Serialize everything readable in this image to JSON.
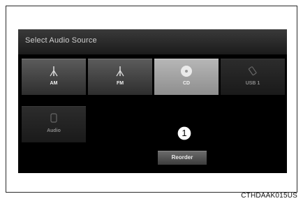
{
  "screen": {
    "header": {
      "title": "Select Audio Source"
    },
    "sources": [
      {
        "label": "AM",
        "icon": "antenna-icon",
        "state": "normal"
      },
      {
        "label": "FM",
        "icon": "antenna-icon",
        "state": "normal"
      },
      {
        "label": "CD",
        "icon": "disc-icon",
        "state": "selected"
      },
      {
        "label": "USB 1",
        "icon": "usb-icon",
        "state": "dim"
      },
      {
        "label": "Audio",
        "icon": "bluetooth-audio-icon",
        "state": "dim"
      }
    ],
    "reorder_label": "Reorder"
  },
  "callout": {
    "number": "1"
  },
  "figure_code": "CTHDAAK015US"
}
